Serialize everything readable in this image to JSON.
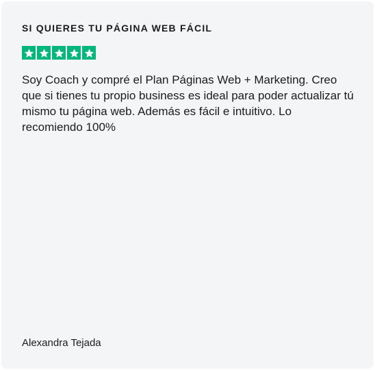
{
  "review": {
    "title": "SI QUIERES TU PÁGINA WEB FÁCIL",
    "rating": 5,
    "max_rating": 5,
    "star_color": "#00b67a",
    "star_icon": "star-icon",
    "body": "Soy Coach y compré el Plan Páginas Web + Marketing. Creo que si tienes tu propio business es ideal para poder actualizar tú mismo tu página web. Además es fácil e intuitivo. Lo recomiendo 100%",
    "author": "Alexandra Tejada"
  }
}
